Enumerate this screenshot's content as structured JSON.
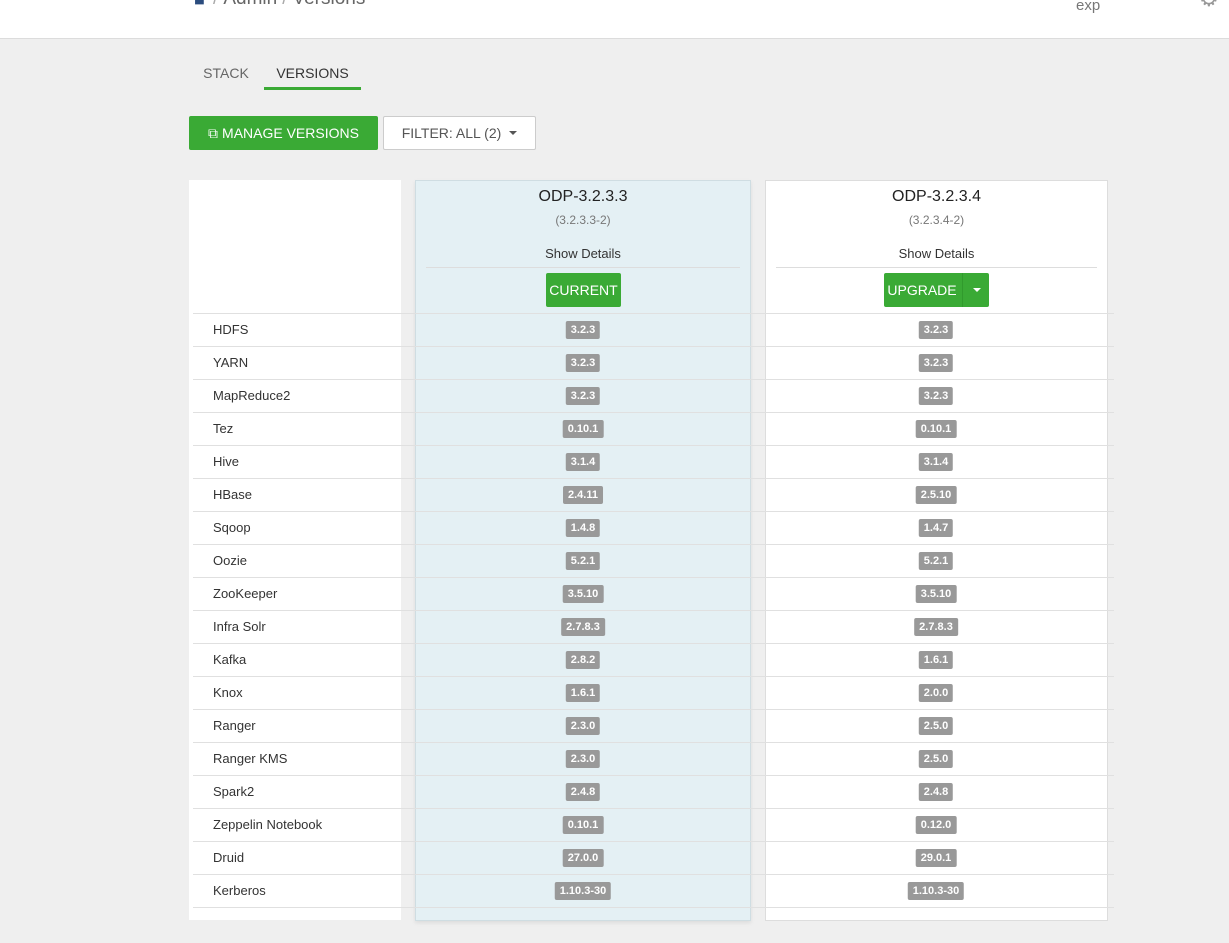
{
  "header": {
    "breadcrumb": [
      "Admin",
      "Versions"
    ],
    "user": "exp"
  },
  "tabs": [
    {
      "label": "STACK",
      "active": false
    },
    {
      "label": "VERSIONS",
      "active": true
    }
  ],
  "toolbar": {
    "manage_label": "MANAGE VERSIONS",
    "filter_label": "FILTER: ALL (2)"
  },
  "versions": [
    {
      "name": "ODP-3.2.3.3",
      "full": "(3.2.3.3-2)",
      "details_label": "Show Details",
      "action_label": "CURRENT",
      "state": "current"
    },
    {
      "name": "ODP-3.2.3.4",
      "full": "(3.2.3.4-2)",
      "details_label": "Show Details",
      "action_label": "UPGRADE",
      "state": "upgrade"
    }
  ],
  "services": [
    {
      "name": "HDFS",
      "current": "3.2.3",
      "upgrade": "3.2.3"
    },
    {
      "name": "YARN",
      "current": "3.2.3",
      "upgrade": "3.2.3"
    },
    {
      "name": "MapReduce2",
      "current": "3.2.3",
      "upgrade": "3.2.3"
    },
    {
      "name": "Tez",
      "current": "0.10.1",
      "upgrade": "0.10.1"
    },
    {
      "name": "Hive",
      "current": "3.1.4",
      "upgrade": "3.1.4"
    },
    {
      "name": "HBase",
      "current": "2.4.11",
      "upgrade": "2.5.10"
    },
    {
      "name": "Sqoop",
      "current": "1.4.8",
      "upgrade": "1.4.7"
    },
    {
      "name": "Oozie",
      "current": "5.2.1",
      "upgrade": "5.2.1"
    },
    {
      "name": "ZooKeeper",
      "current": "3.5.10",
      "upgrade": "3.5.10"
    },
    {
      "name": "Infra Solr",
      "current": "2.7.8.3",
      "upgrade": "2.7.8.3"
    },
    {
      "name": "Kafka",
      "current": "2.8.2",
      "upgrade": "1.6.1"
    },
    {
      "name": "Knox",
      "current": "1.6.1",
      "upgrade": "2.0.0"
    },
    {
      "name": "Ranger",
      "current": "2.3.0",
      "upgrade": "2.5.0"
    },
    {
      "name": "Ranger KMS",
      "current": "2.3.0",
      "upgrade": "2.5.0"
    },
    {
      "name": "Spark2",
      "current": "2.4.8",
      "upgrade": "2.4.8"
    },
    {
      "name": "Zeppelin Notebook",
      "current": "0.10.1",
      "upgrade": "0.12.0"
    },
    {
      "name": "Druid",
      "current": "27.0.0",
      "upgrade": "29.0.1"
    },
    {
      "name": "Kerberos",
      "current": "1.10.3-30",
      "upgrade": "1.10.3-30"
    }
  ],
  "colors": {
    "accent": "#3aaa35",
    "badge": "#999999",
    "current_column": "#e4f0f4"
  }
}
